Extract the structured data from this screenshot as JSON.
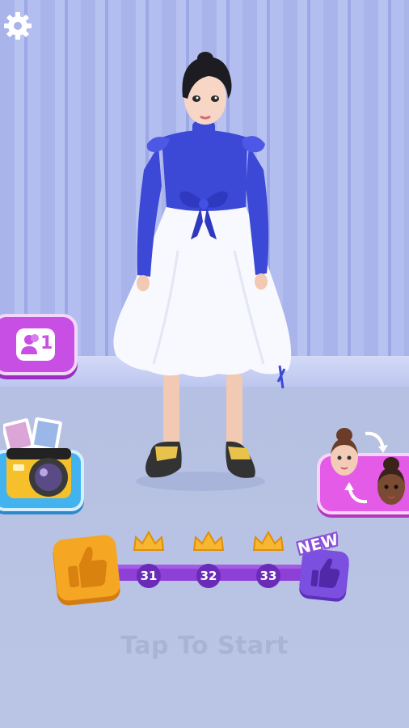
{
  "screen": {
    "tap_to_start": "Tap To Start"
  },
  "icons": {
    "settings": "gear-icon",
    "friends": "friends-icon",
    "camera": "camera-icon",
    "face_swap": "face-swap-icon",
    "thumbs_up": "thumbs-up-icon",
    "crown": "crown-icon"
  },
  "friends_button": {
    "count": "1"
  },
  "progress": {
    "levels": [
      "31",
      "32",
      "33"
    ],
    "new_label": "NEW"
  },
  "colors": {
    "purple_button": "#c84fe4",
    "blue_button": "#43b3f0",
    "pink_button": "#e35be7",
    "current_level_tile": "#f5a623",
    "next_level_tile": "#7b4fe0",
    "progress_bar": "#8e3fd6",
    "dress_top": "#3c48d6",
    "dress_skirt": "#ffffff"
  }
}
